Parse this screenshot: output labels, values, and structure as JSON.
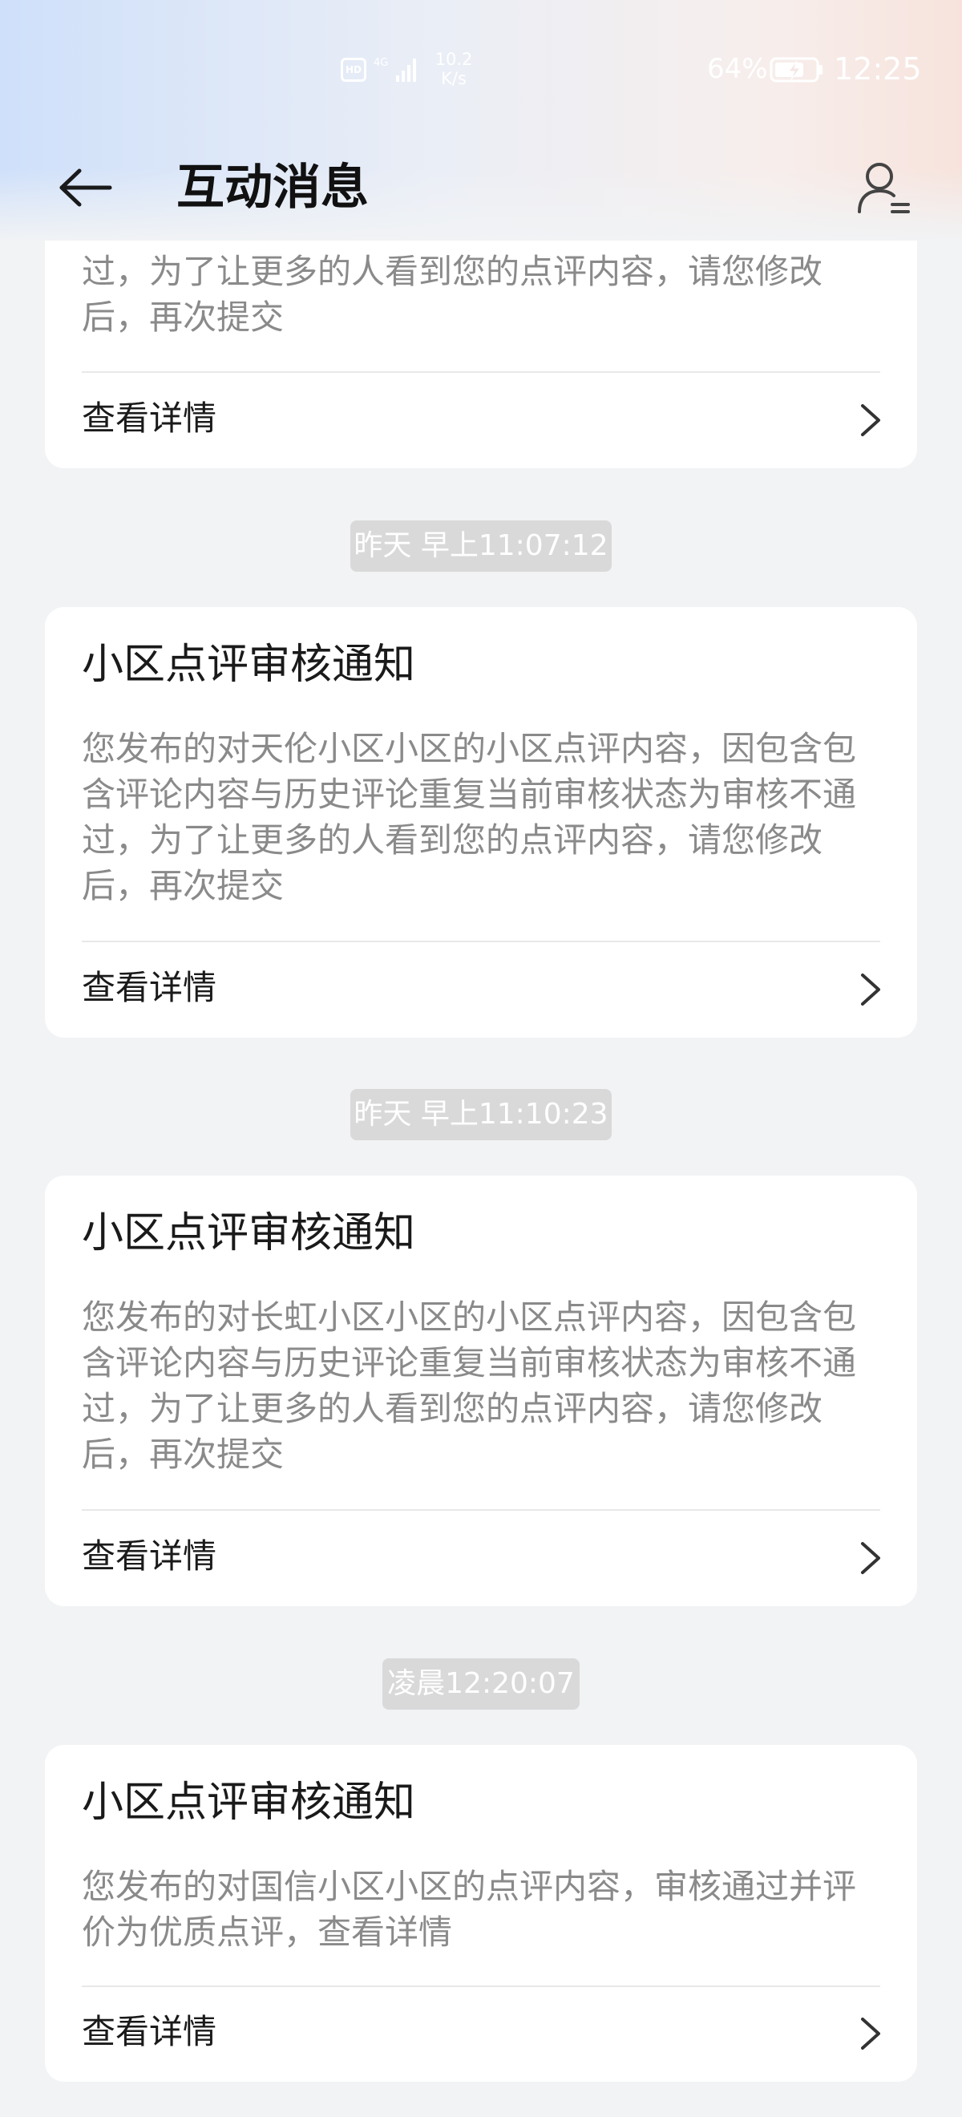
{
  "status_bar": {
    "hd_label": "HD",
    "network_type": "4G",
    "net_speed_value": "10.2",
    "net_speed_unit": "K/s",
    "battery_percent": "64%",
    "time": "12:25"
  },
  "header": {
    "title": "互动消息"
  },
  "icons": {
    "back": "arrow-left-icon",
    "profile": "user-list-icon",
    "chevron": "chevron-right-icon"
  },
  "messages": [
    {
      "title": "",
      "body_visible": "过，为了让更多的人看到您的点评内容，请您修改后，再次提交",
      "details_label": "查看详情"
    },
    {
      "timestamp": "昨天 早上11:07:12",
      "title": "小区点评审核通知",
      "body": "您发布的对天伦小区小区的小区点评内容，因包含包含评论内容与历史评论重复当前审核状态为审核不通过，为了让更多的人看到您的点评内容，请您修改后，再次提交",
      "details_label": "查看详情"
    },
    {
      "timestamp": "昨天 早上11:10:23",
      "title": "小区点评审核通知",
      "body": "您发布的对长虹小区小区的小区点评内容，因包含包含评论内容与历史评论重复当前审核状态为审核不通过，为了让更多的人看到您的点评内容，请您修改后，再次提交",
      "details_label": "查看详情"
    },
    {
      "timestamp": "凌晨12:20:07",
      "title": "小区点评审核通知",
      "body": "您发布的对国信小区小区的点评内容，审核通过并评价为优质点评，查看详情",
      "details_label": "查看详情"
    }
  ],
  "colors": {
    "page_background": "#f1f3f5",
    "card_background": "#ffffff",
    "title_text": "#1a1a1a",
    "body_text": "#8a8a8a",
    "timestamp_pill": "#d9d9d9"
  }
}
